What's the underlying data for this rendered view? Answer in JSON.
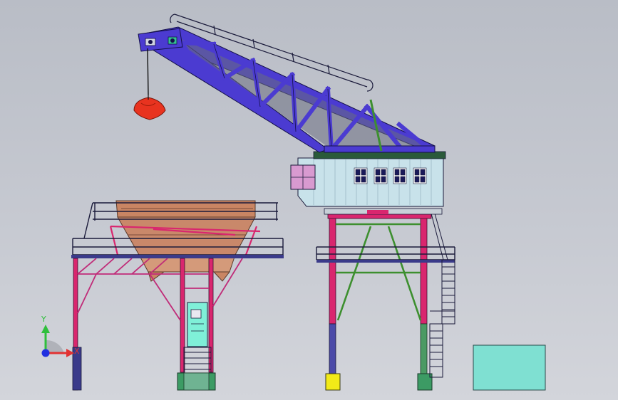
{
  "viewport": {
    "background_top": "#b9bdc6",
    "background_bottom": "#d3d5db"
  },
  "model": {
    "components": [
      "hopper-platform",
      "hopper-bin",
      "portal-crane",
      "crane-jib",
      "grab-bucket",
      "operator-cab",
      "portal-legs",
      "access-stairs",
      "ground-block"
    ],
    "colors": {
      "jib": "#4b3bd1",
      "legs": "#d9266e",
      "braces": "#3d8f2f",
      "hopper": "#c98563",
      "grab": "#e8331f",
      "cab": "#c8e2ea",
      "ground_block": "#7fe0d2",
      "foot_yellow": "#f2ea18",
      "foot_green": "#3c9b64"
    }
  },
  "triad": {
    "y_label": "Y",
    "x_label": "X",
    "y_color": "#2fbf3c",
    "x_color": "#e23232",
    "origin_color": "#2030e0"
  }
}
